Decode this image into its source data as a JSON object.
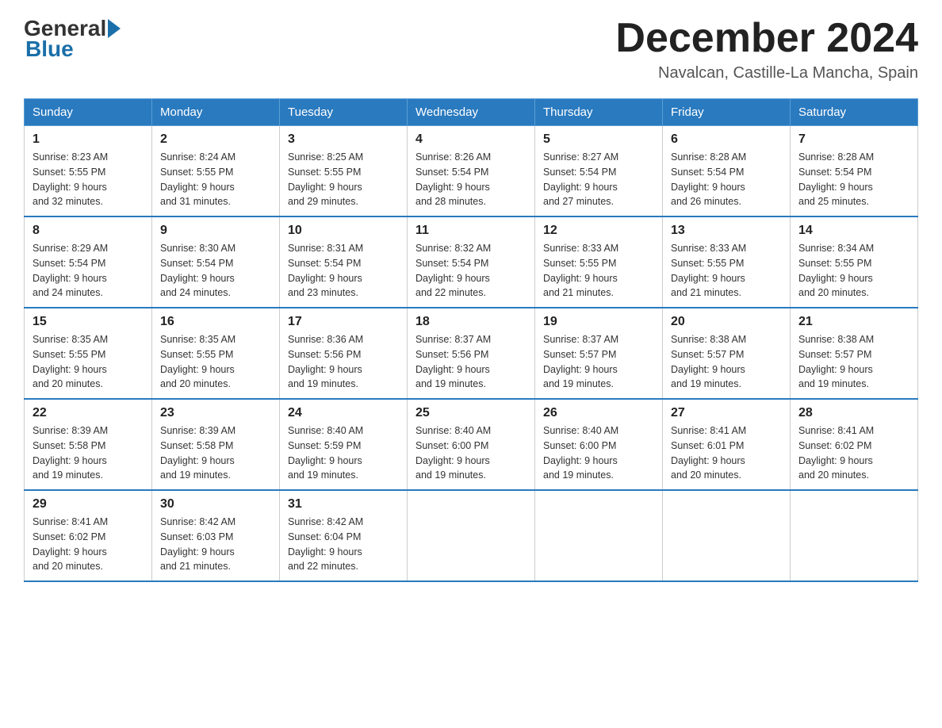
{
  "header": {
    "logo_general": "General",
    "logo_blue": "Blue",
    "month_title": "December 2024",
    "location": "Navalcan, Castille-La Mancha, Spain"
  },
  "days_of_week": [
    "Sunday",
    "Monday",
    "Tuesday",
    "Wednesday",
    "Thursday",
    "Friday",
    "Saturday"
  ],
  "weeks": [
    [
      {
        "day": "1",
        "sunrise": "8:23 AM",
        "sunset": "5:55 PM",
        "daylight": "9 hours and 32 minutes."
      },
      {
        "day": "2",
        "sunrise": "8:24 AM",
        "sunset": "5:55 PM",
        "daylight": "9 hours and 31 minutes."
      },
      {
        "day": "3",
        "sunrise": "8:25 AM",
        "sunset": "5:55 PM",
        "daylight": "9 hours and 29 minutes."
      },
      {
        "day": "4",
        "sunrise": "8:26 AM",
        "sunset": "5:54 PM",
        "daylight": "9 hours and 28 minutes."
      },
      {
        "day": "5",
        "sunrise": "8:27 AM",
        "sunset": "5:54 PM",
        "daylight": "9 hours and 27 minutes."
      },
      {
        "day": "6",
        "sunrise": "8:28 AM",
        "sunset": "5:54 PM",
        "daylight": "9 hours and 26 minutes."
      },
      {
        "day": "7",
        "sunrise": "8:28 AM",
        "sunset": "5:54 PM",
        "daylight": "9 hours and 25 minutes."
      }
    ],
    [
      {
        "day": "8",
        "sunrise": "8:29 AM",
        "sunset": "5:54 PM",
        "daylight": "9 hours and 24 minutes."
      },
      {
        "day": "9",
        "sunrise": "8:30 AM",
        "sunset": "5:54 PM",
        "daylight": "9 hours and 24 minutes."
      },
      {
        "day": "10",
        "sunrise": "8:31 AM",
        "sunset": "5:54 PM",
        "daylight": "9 hours and 23 minutes."
      },
      {
        "day": "11",
        "sunrise": "8:32 AM",
        "sunset": "5:54 PM",
        "daylight": "9 hours and 22 minutes."
      },
      {
        "day": "12",
        "sunrise": "8:33 AM",
        "sunset": "5:55 PM",
        "daylight": "9 hours and 21 minutes."
      },
      {
        "day": "13",
        "sunrise": "8:33 AM",
        "sunset": "5:55 PM",
        "daylight": "9 hours and 21 minutes."
      },
      {
        "day": "14",
        "sunrise": "8:34 AM",
        "sunset": "5:55 PM",
        "daylight": "9 hours and 20 minutes."
      }
    ],
    [
      {
        "day": "15",
        "sunrise": "8:35 AM",
        "sunset": "5:55 PM",
        "daylight": "9 hours and 20 minutes."
      },
      {
        "day": "16",
        "sunrise": "8:35 AM",
        "sunset": "5:55 PM",
        "daylight": "9 hours and 20 minutes."
      },
      {
        "day": "17",
        "sunrise": "8:36 AM",
        "sunset": "5:56 PM",
        "daylight": "9 hours and 19 minutes."
      },
      {
        "day": "18",
        "sunrise": "8:37 AM",
        "sunset": "5:56 PM",
        "daylight": "9 hours and 19 minutes."
      },
      {
        "day": "19",
        "sunrise": "8:37 AM",
        "sunset": "5:57 PM",
        "daylight": "9 hours and 19 minutes."
      },
      {
        "day": "20",
        "sunrise": "8:38 AM",
        "sunset": "5:57 PM",
        "daylight": "9 hours and 19 minutes."
      },
      {
        "day": "21",
        "sunrise": "8:38 AM",
        "sunset": "5:57 PM",
        "daylight": "9 hours and 19 minutes."
      }
    ],
    [
      {
        "day": "22",
        "sunrise": "8:39 AM",
        "sunset": "5:58 PM",
        "daylight": "9 hours and 19 minutes."
      },
      {
        "day": "23",
        "sunrise": "8:39 AM",
        "sunset": "5:58 PM",
        "daylight": "9 hours and 19 minutes."
      },
      {
        "day": "24",
        "sunrise": "8:40 AM",
        "sunset": "5:59 PM",
        "daylight": "9 hours and 19 minutes."
      },
      {
        "day": "25",
        "sunrise": "8:40 AM",
        "sunset": "6:00 PM",
        "daylight": "9 hours and 19 minutes."
      },
      {
        "day": "26",
        "sunrise": "8:40 AM",
        "sunset": "6:00 PM",
        "daylight": "9 hours and 19 minutes."
      },
      {
        "day": "27",
        "sunrise": "8:41 AM",
        "sunset": "6:01 PM",
        "daylight": "9 hours and 20 minutes."
      },
      {
        "day": "28",
        "sunrise": "8:41 AM",
        "sunset": "6:02 PM",
        "daylight": "9 hours and 20 minutes."
      }
    ],
    [
      {
        "day": "29",
        "sunrise": "8:41 AM",
        "sunset": "6:02 PM",
        "daylight": "9 hours and 20 minutes."
      },
      {
        "day": "30",
        "sunrise": "8:42 AM",
        "sunset": "6:03 PM",
        "daylight": "9 hours and 21 minutes."
      },
      {
        "day": "31",
        "sunrise": "8:42 AM",
        "sunset": "6:04 PM",
        "daylight": "9 hours and 22 minutes."
      },
      null,
      null,
      null,
      null
    ]
  ],
  "labels": {
    "sunrise": "Sunrise:",
    "sunset": "Sunset:",
    "daylight": "Daylight:"
  }
}
